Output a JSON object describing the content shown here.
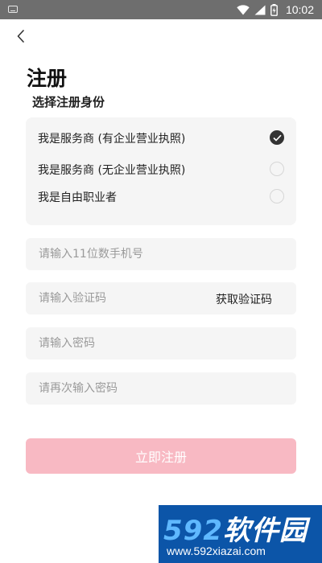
{
  "status_bar": {
    "time": "10:02"
  },
  "page": {
    "title": "注册",
    "subtitle": "选择注册身份"
  },
  "roles": [
    {
      "label": "我是服务商 (有企业营业执照)",
      "checked": true
    },
    {
      "label": "我是服务商 (无企业营业执照)",
      "checked": false
    },
    {
      "label": "我是自由职业者",
      "checked": false
    }
  ],
  "form": {
    "phone_placeholder": "请输入11位数手机号",
    "code_placeholder": "请输入验证码",
    "get_code_label": "获取验证码",
    "password_placeholder": "请输入密码",
    "confirm_password_placeholder": "请再次输入密码"
  },
  "register_button": "立即注册",
  "watermark": {
    "brand_number": "592",
    "brand_text": "软件园",
    "url": "www.592xiazai.com"
  },
  "colors": {
    "status_bar": "#6e6e6e",
    "field_bg": "#f5f5f5",
    "button_bg": "#f8b9c3",
    "watermark_bg": "#0c55a8"
  }
}
